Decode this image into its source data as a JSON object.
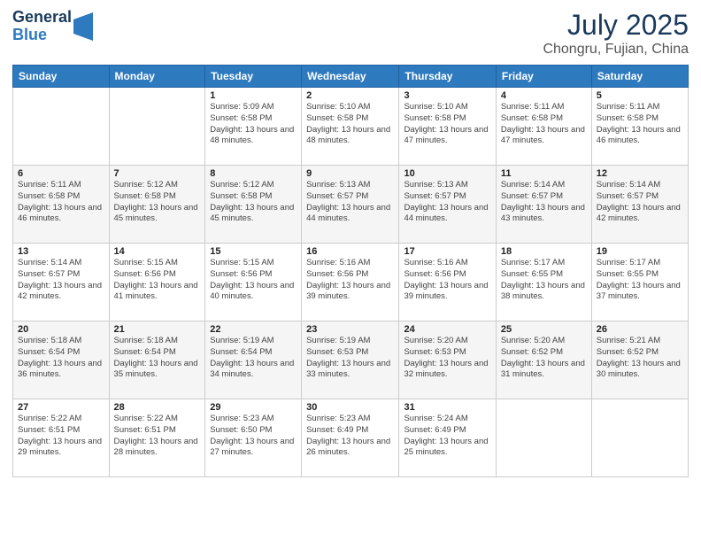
{
  "header": {
    "logo_general": "General",
    "logo_blue": "Blue",
    "month_year": "July 2025",
    "location": "Chongru, Fujian, China"
  },
  "weekdays": [
    "Sunday",
    "Monday",
    "Tuesday",
    "Wednesday",
    "Thursday",
    "Friday",
    "Saturday"
  ],
  "weeks": [
    [
      {
        "day": "",
        "info": ""
      },
      {
        "day": "",
        "info": ""
      },
      {
        "day": "1",
        "info": "Sunrise: 5:09 AM\nSunset: 6:58 PM\nDaylight: 13 hours and 48 minutes."
      },
      {
        "day": "2",
        "info": "Sunrise: 5:10 AM\nSunset: 6:58 PM\nDaylight: 13 hours and 48 minutes."
      },
      {
        "day": "3",
        "info": "Sunrise: 5:10 AM\nSunset: 6:58 PM\nDaylight: 13 hours and 47 minutes."
      },
      {
        "day": "4",
        "info": "Sunrise: 5:11 AM\nSunset: 6:58 PM\nDaylight: 13 hours and 47 minutes."
      },
      {
        "day": "5",
        "info": "Sunrise: 5:11 AM\nSunset: 6:58 PM\nDaylight: 13 hours and 46 minutes."
      }
    ],
    [
      {
        "day": "6",
        "info": "Sunrise: 5:11 AM\nSunset: 6:58 PM\nDaylight: 13 hours and 46 minutes."
      },
      {
        "day": "7",
        "info": "Sunrise: 5:12 AM\nSunset: 6:58 PM\nDaylight: 13 hours and 45 minutes."
      },
      {
        "day": "8",
        "info": "Sunrise: 5:12 AM\nSunset: 6:58 PM\nDaylight: 13 hours and 45 minutes."
      },
      {
        "day": "9",
        "info": "Sunrise: 5:13 AM\nSunset: 6:57 PM\nDaylight: 13 hours and 44 minutes."
      },
      {
        "day": "10",
        "info": "Sunrise: 5:13 AM\nSunset: 6:57 PM\nDaylight: 13 hours and 44 minutes."
      },
      {
        "day": "11",
        "info": "Sunrise: 5:14 AM\nSunset: 6:57 PM\nDaylight: 13 hours and 43 minutes."
      },
      {
        "day": "12",
        "info": "Sunrise: 5:14 AM\nSunset: 6:57 PM\nDaylight: 13 hours and 42 minutes."
      }
    ],
    [
      {
        "day": "13",
        "info": "Sunrise: 5:14 AM\nSunset: 6:57 PM\nDaylight: 13 hours and 42 minutes."
      },
      {
        "day": "14",
        "info": "Sunrise: 5:15 AM\nSunset: 6:56 PM\nDaylight: 13 hours and 41 minutes."
      },
      {
        "day": "15",
        "info": "Sunrise: 5:15 AM\nSunset: 6:56 PM\nDaylight: 13 hours and 40 minutes."
      },
      {
        "day": "16",
        "info": "Sunrise: 5:16 AM\nSunset: 6:56 PM\nDaylight: 13 hours and 39 minutes."
      },
      {
        "day": "17",
        "info": "Sunrise: 5:16 AM\nSunset: 6:56 PM\nDaylight: 13 hours and 39 minutes."
      },
      {
        "day": "18",
        "info": "Sunrise: 5:17 AM\nSunset: 6:55 PM\nDaylight: 13 hours and 38 minutes."
      },
      {
        "day": "19",
        "info": "Sunrise: 5:17 AM\nSunset: 6:55 PM\nDaylight: 13 hours and 37 minutes."
      }
    ],
    [
      {
        "day": "20",
        "info": "Sunrise: 5:18 AM\nSunset: 6:54 PM\nDaylight: 13 hours and 36 minutes."
      },
      {
        "day": "21",
        "info": "Sunrise: 5:18 AM\nSunset: 6:54 PM\nDaylight: 13 hours and 35 minutes."
      },
      {
        "day": "22",
        "info": "Sunrise: 5:19 AM\nSunset: 6:54 PM\nDaylight: 13 hours and 34 minutes."
      },
      {
        "day": "23",
        "info": "Sunrise: 5:19 AM\nSunset: 6:53 PM\nDaylight: 13 hours and 33 minutes."
      },
      {
        "day": "24",
        "info": "Sunrise: 5:20 AM\nSunset: 6:53 PM\nDaylight: 13 hours and 32 minutes."
      },
      {
        "day": "25",
        "info": "Sunrise: 5:20 AM\nSunset: 6:52 PM\nDaylight: 13 hours and 31 minutes."
      },
      {
        "day": "26",
        "info": "Sunrise: 5:21 AM\nSunset: 6:52 PM\nDaylight: 13 hours and 30 minutes."
      }
    ],
    [
      {
        "day": "27",
        "info": "Sunrise: 5:22 AM\nSunset: 6:51 PM\nDaylight: 13 hours and 29 minutes."
      },
      {
        "day": "28",
        "info": "Sunrise: 5:22 AM\nSunset: 6:51 PM\nDaylight: 13 hours and 28 minutes."
      },
      {
        "day": "29",
        "info": "Sunrise: 5:23 AM\nSunset: 6:50 PM\nDaylight: 13 hours and 27 minutes."
      },
      {
        "day": "30",
        "info": "Sunrise: 5:23 AM\nSunset: 6:49 PM\nDaylight: 13 hours and 26 minutes."
      },
      {
        "day": "31",
        "info": "Sunrise: 5:24 AM\nSunset: 6:49 PM\nDaylight: 13 hours and 25 minutes."
      },
      {
        "day": "",
        "info": ""
      },
      {
        "day": "",
        "info": ""
      }
    ]
  ]
}
